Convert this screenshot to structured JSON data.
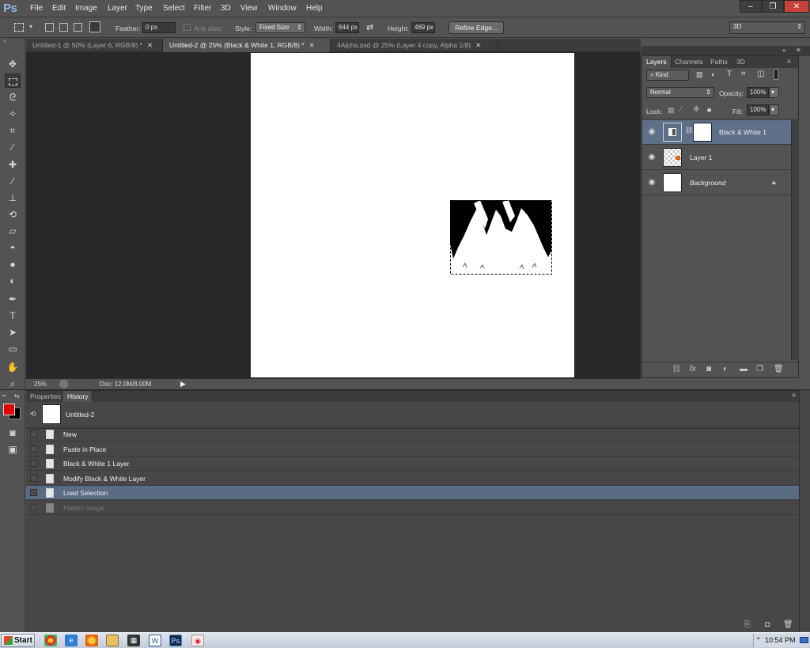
{
  "app": {
    "logo": "Ps"
  },
  "menu": [
    "File",
    "Edit",
    "Image",
    "Layer",
    "Type",
    "Select",
    "Filter",
    "3D",
    "View",
    "Window",
    "Help"
  ],
  "window_controls": {
    "minimize": "–",
    "restore": "❐",
    "close": "✕"
  },
  "options": {
    "feather_label": "Feather:",
    "feather_value": "0 px",
    "antialias_label": "Anti-alias",
    "style_label": "Style:",
    "style_value": "Fixed Size",
    "width_label": "Width:",
    "width_value": "644 px",
    "height_label": "Height:",
    "height_value": "469 px",
    "refine_edge": "Refine Edge...",
    "workspace": "3D"
  },
  "doc_tabs": [
    {
      "label": "Untitled-1 @ 50% (Layer 6, RGB/8) *",
      "active": false
    },
    {
      "label": "Untitled-2 @ 25% (Black & White 1, RGB/8) *",
      "active": true
    },
    {
      "label": "4Alpha.psd @ 25% (Layer 4 copy, Alpha 1/8)",
      "active": false
    }
  ],
  "status": {
    "zoom": "25%",
    "doc_size": "Doc: 12.0M/8.00M"
  },
  "layers_panel": {
    "tabs": [
      "Layers",
      "Channels",
      "Paths",
      "3D"
    ],
    "filter": "Kind",
    "blend_mode": "Normal",
    "opacity_label": "Opacity:",
    "opacity_value": "100%",
    "lock_label": "Lock:",
    "fill_label": "Fill:",
    "fill_value": "100%",
    "layers": [
      {
        "name": "Black & White 1",
        "selected": true
      },
      {
        "name": "Layer 1",
        "selected": false
      },
      {
        "name": "Background",
        "selected": false,
        "locked": true
      }
    ],
    "footer_icons": [
      "link-icon",
      "fx-icon",
      "mask-icon",
      "adjustment-icon",
      "folder-icon",
      "new-layer-icon",
      "trash-icon"
    ]
  },
  "history_panel": {
    "tabs": [
      "Properties",
      "History"
    ],
    "snapshot": "Untitled-2",
    "items": [
      {
        "label": "New",
        "state": "normal"
      },
      {
        "label": "Paste in Place",
        "state": "normal"
      },
      {
        "label": "Black & White 1 Layer",
        "state": "normal"
      },
      {
        "label": "Modify Black & White Layer",
        "state": "normal"
      },
      {
        "label": "Load Selection",
        "state": "selected"
      },
      {
        "label": "Flatten Image",
        "state": "undone"
      }
    ]
  },
  "colors": {
    "foreground": "#e00000",
    "background": "#000000",
    "selection_highlight": "#5e6f88"
  },
  "taskbar": {
    "start": "Start",
    "time": "10:54 PM"
  }
}
